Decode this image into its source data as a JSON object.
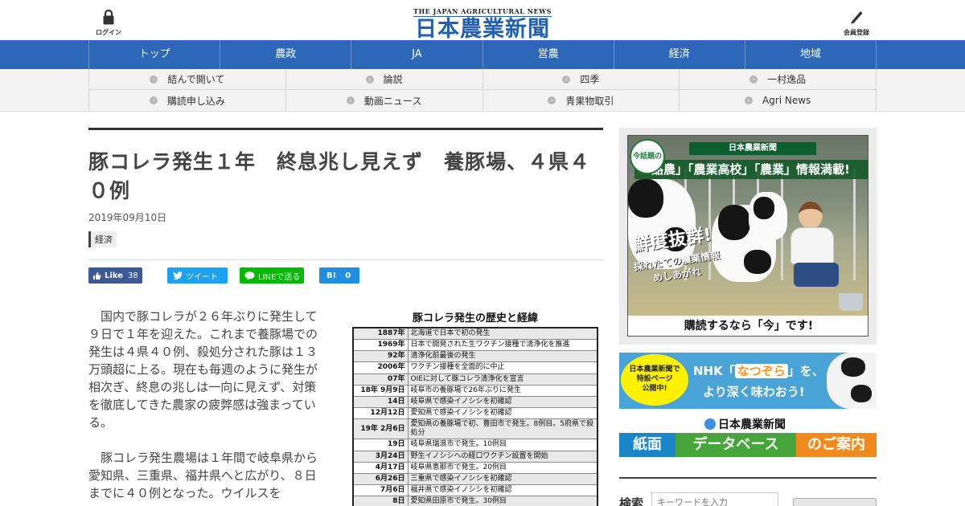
{
  "header": {
    "login_label": "ログイン",
    "member_label": "会員登録",
    "logo_en": "THE JAPAN AGRICULTURAL NEWS",
    "logo_jp": "日本農業新聞"
  },
  "main_nav": [
    "トップ",
    "農政",
    "JA",
    "営農",
    "経済",
    "地域"
  ],
  "sub_nav": [
    "結んで開いて",
    "論説",
    "四季",
    "一村逸品",
    "購読申し込み",
    "動画ニュース",
    "青果物取引",
    "Agri News"
  ],
  "article": {
    "title": "豚コレラ発生１年　終息兆し見えず　養豚場、４県４０例",
    "date": "2019年09月10日",
    "category": "経済",
    "share": {
      "fb_label": "Like",
      "fb_count": "38",
      "tw_label": "ツイート",
      "line_label": "LINEで送る",
      "hb_label": "B!",
      "hb_count": "0"
    },
    "paragraphs": [
      "国内で豚コレラが２６年ぶりに発生して９日で１年を迎えた。これまで養豚場での発生は４県４０例、殺処分された豚は１３万頭超に上る。現在も毎週のように発生が相次ぎ、終息の兆しは一向に見えず、対策を徹底してきた農家の疲弊感は強まっている。",
      "豚コレラ発生農場は１年間で岐阜県から愛知県、三重県、福井県へと広がり、８日までに４０例となった。ウイルスを"
    ],
    "figure": {
      "title": "豚コレラ発生の歴史と経緯",
      "rows": [
        {
          "year": "1887年",
          "text": "北海道で日本で初の発生"
        },
        {
          "year": "1969年",
          "text": "日本で開発された生ワクチン接種で清浄化を推進"
        },
        {
          "year": "92年",
          "text": "清浄化前最後の発生"
        },
        {
          "year": "2006年",
          "text": "ワクチン接種を全面的に中止"
        },
        {
          "year": "07年",
          "text": "OIEに対して豚コレラ清浄化を宣言"
        },
        {
          "year": "18年  9月9日",
          "text": "岐阜市の養豚場で26年ぶりに発生"
        },
        {
          "year": "14日",
          "text": "岐阜県で感染イノシシを初確認"
        },
        {
          "year": "12月12日",
          "text": "愛知県で感染イノシシを初確認"
        },
        {
          "year": "19年  2月6日",
          "text": "愛知県の養豚場で初、豊田市で発生。8例目。5府県で殺処分"
        },
        {
          "year": "19日",
          "text": "岐阜県瑞浪市で発生。10例目"
        },
        {
          "year": "3月24日",
          "text": "野生イノシシへの経口ワクチン設置を開始"
        },
        {
          "year": "4月17日",
          "text": "岐阜県恵那市で発生。20例目"
        },
        {
          "year": "6月26日",
          "text": "三重県で感染イノシシを初確認"
        },
        {
          "year": "7月6日",
          "text": "福井県で感染イノシシを初確認"
        },
        {
          "year": "8日",
          "text": "愛知県田原市で発生。30例目"
        }
      ]
    }
  },
  "sidebar": {
    "ad1": {
      "banner_title": "日本農業新聞",
      "burst": "今話題の",
      "tagline": "「酪農」「農業高校」「農業」情報満載!",
      "big_text": "鮮度抜群!",
      "small_text_1": "採れたての農業情報",
      "small_text_2": "めしあがれ",
      "footer": "購読するなら「今」です!"
    },
    "ad2": {
      "badge_1": "日本農業新聞で",
      "badge_2": "特設ページ",
      "badge_3": "公開中!",
      "line1_pre": "NHK「",
      "line1_hl": "なつぞら",
      "line1_post": "」を、",
      "line2": "より深く味わおう!"
    },
    "ad3": {
      "logo": "日本農業新聞",
      "part_a": "紙面",
      "part_b": "データベース",
      "part_c": "のご案内"
    },
    "search": {
      "label": "検索",
      "placeholder": "キーワードを入力"
    }
  },
  "colors": {
    "nav_blue": "#2e67b8",
    "logo_blue": "#2460b0",
    "facebook": "#3d5a98",
    "twitter": "#1da1f2",
    "line": "#00b900",
    "hatena": "#1f8ee0"
  },
  "icons": {
    "login": "lock-icon",
    "member": "pen-icon",
    "sub_nav_bullet": "circle-chevron-icon"
  }
}
